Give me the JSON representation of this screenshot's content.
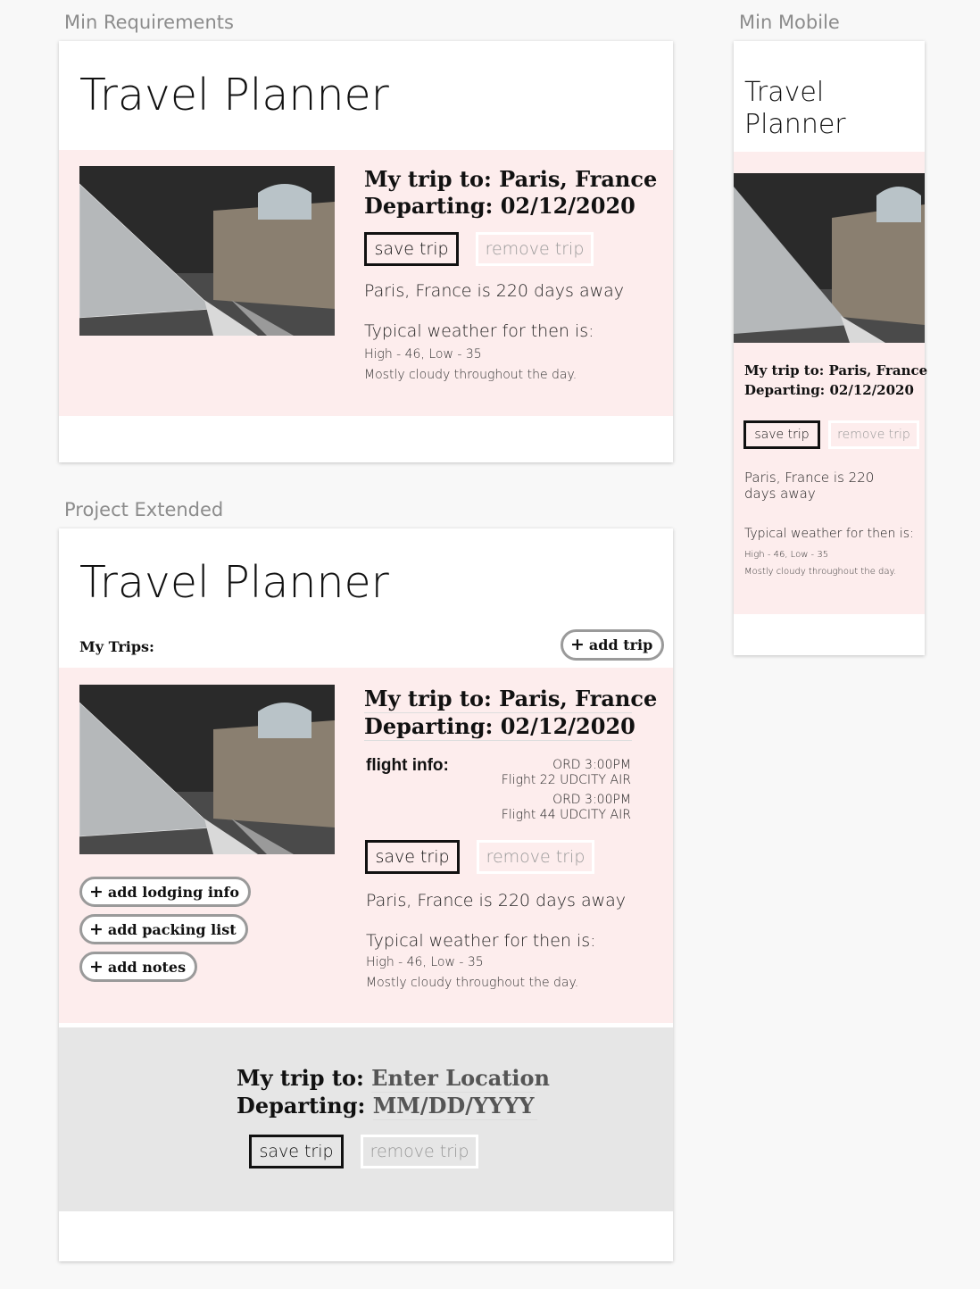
{
  "labels": {
    "min_requirements": "Min Requirements",
    "min_mobile": "Min Mobile",
    "project_extended": "Project Extended"
  },
  "app_title": "Travel Planner",
  "mobile_title_line1": "Travel",
  "mobile_title_line2": "Planner",
  "trip": {
    "my_trip_label": "My trip to:",
    "location": "Paris, France",
    "departing_label": "Departing:",
    "date": "02/12/2020",
    "save_label": "save trip",
    "remove_label": "remove trip",
    "days_away": "Paris, France is 220 days away",
    "days_away_line1": "Paris, France is 220",
    "days_away_line2": "days away",
    "weather_heading": "Typical weather for then is:",
    "weather_temps": "High - 46, Low - 35",
    "weather_summary": "Mostly cloudy throughout the day."
  },
  "extended": {
    "my_trips_label": "My Trips:",
    "add_trip_label": "add trip",
    "flight_info_label": "flight info:",
    "flights": [
      {
        "airport_time": "ORD 3:00PM",
        "flight_line": "Flight 22  UDCITY AIR"
      },
      {
        "airport_time": "ORD 3:00PM",
        "flight_line": "Flight 44  UDCITY AIR"
      }
    ],
    "add_lodging_label": "add lodging info",
    "add_packing_label": "add packing list",
    "add_notes_label": "add notes"
  },
  "new_trip_form": {
    "my_trip_label": "My trip to:",
    "location_placeholder": "Enter Location",
    "departing_label": "Departing:",
    "date_placeholder": "MM/DD/YYYY",
    "save_label": "save trip",
    "remove_label": "remove trip"
  },
  "colors": {
    "page_bg": "#f8f8f8",
    "pink_band": "#fdeded",
    "grey_band": "#e6e6e6",
    "label_grey": "#8c8c8c"
  },
  "icons": {
    "plus": "+"
  }
}
